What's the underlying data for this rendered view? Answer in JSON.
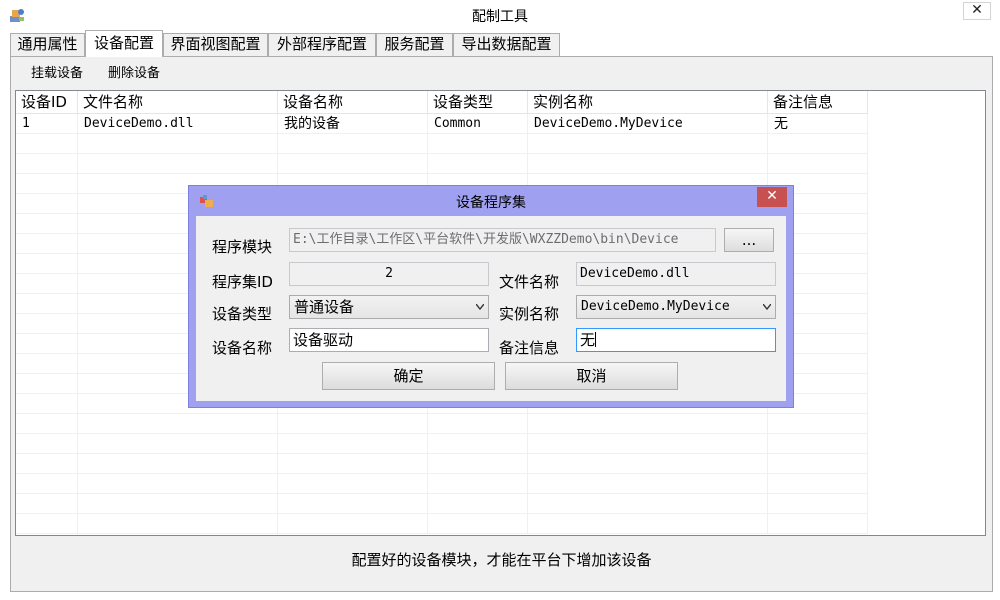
{
  "window": {
    "title": "配制工具",
    "close_glyph": "✕",
    "icon": "app-icon"
  },
  "tabs": [
    {
      "label": "通用属性",
      "active": false
    },
    {
      "label": "设备配置",
      "active": true
    },
    {
      "label": "界面视图配置",
      "active": false
    },
    {
      "label": "外部程序配置",
      "active": false
    },
    {
      "label": "服务配置",
      "active": false
    },
    {
      "label": "导出数据配置",
      "active": false
    }
  ],
  "toolbar": {
    "mount_label": "挂载设备",
    "delete_label": "删除设备"
  },
  "table": {
    "headers": [
      "设备ID",
      "文件名称",
      "设备名称",
      "设备类型",
      "实例名称",
      "备注信息"
    ],
    "rows": [
      [
        "1",
        "DeviceDemo.dll",
        "我的设备",
        "Common",
        "DeviceDemo.MyDevice",
        "无"
      ]
    ]
  },
  "footer": {
    "message": "配置好的设备模块，才能在平台下增加该设备"
  },
  "dialog": {
    "title": "设备程序集",
    "close_glyph": "✕",
    "icon": "dialog-app-icon",
    "module_label": "程序模块",
    "module_value": "E:\\工作目录\\工作区\\平台软件\\开发版\\WXZZDemo\\bin\\Device",
    "browse_label": "...",
    "assembly_id_label": "程序集ID",
    "assembly_id_value": "2",
    "file_name_label": "文件名称",
    "file_name_value": "DeviceDemo.dll",
    "device_type_label": "设备类型",
    "device_type_value": "普通设备",
    "instance_label": "实例名称",
    "instance_value": "DeviceDemo.MyDevice",
    "device_name_label": "设备名称",
    "device_name_value": "设备驱动",
    "remark_label": "备注信息",
    "remark_value": "无",
    "ok_label": "确定",
    "cancel_label": "取消"
  },
  "colors": {
    "dialog_frame": "#9fa1f0",
    "close_button": "#c75050",
    "focus_border": "#3399ff"
  }
}
